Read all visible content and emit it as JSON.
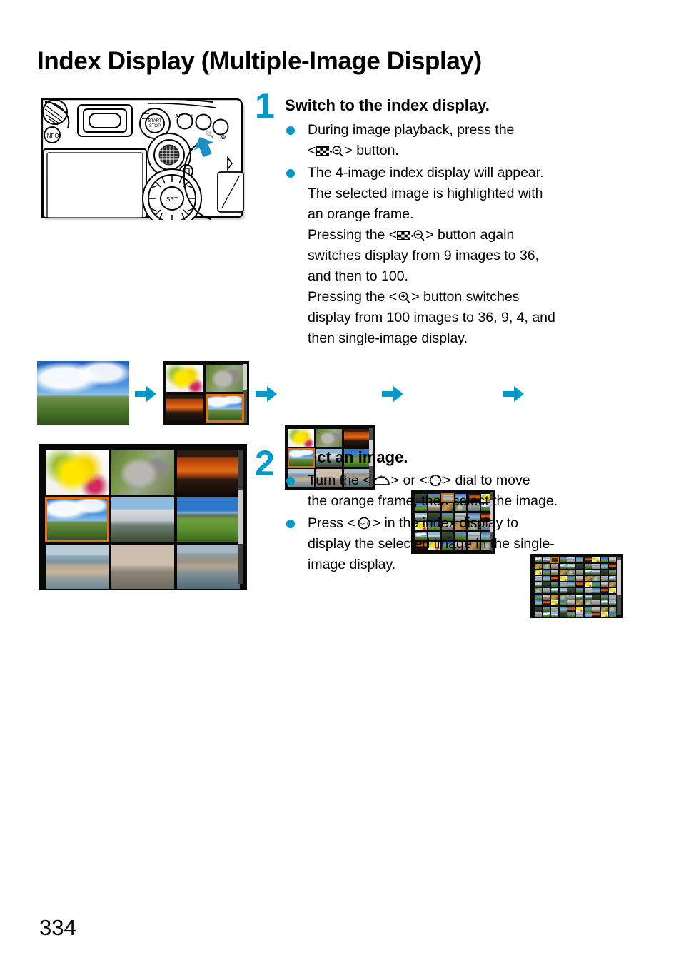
{
  "page": {
    "title": "Index Display (Multiple-Image Display)",
    "number": "334"
  },
  "colors": {
    "accent_cyan": "#0099cc",
    "selection_orange": "#e2710b",
    "text_black": "#000000",
    "lcd_background": "#0a0a0a"
  },
  "steps": [
    {
      "number": "1",
      "heading": "Switch to the index display.",
      "bullets": [
        {
          "lines": [
            {
              "text": "During image playback, press the"
            },
            {
              "pre": "<",
              "icon": "index-magnify-minus-icon",
              "post": "> button."
            }
          ]
        },
        {
          "lines": [
            {
              "text": "The 4-image index display will appear."
            },
            {
              "text": "The selected image is highlighted with"
            },
            {
              "text": "an orange frame."
            },
            {
              "pre": "Pressing the <",
              "icon": "index-magnify-minus-icon",
              "post": "> button again"
            },
            {
              "text": "switches display from 9 images to 36,"
            },
            {
              "text": "and then to 100."
            },
            {
              "pre": "Pressing the <",
              "icon": "magnify-plus-icon",
              "post": "> button switches"
            },
            {
              "text": "display from 100 images to 36, 9, 4, and"
            },
            {
              "text": "then single-image display."
            }
          ]
        }
      ]
    },
    {
      "number": "2",
      "heading": "Select an image.",
      "bullets": [
        {
          "lines": [
            {
              "pre": "Turn the <",
              "icon": "main-dial-icon",
              "mid": "> or <",
              "icon2": "quick-control-dial-icon",
              "post": "> dial to move"
            },
            {
              "text": "the orange frame, then select the image."
            }
          ]
        },
        {
          "lines": [
            {
              "pre": "Press <",
              "icon": "set-button-icon",
              "post": "> in the index display to"
            },
            {
              "text": "display the selected image in the single-"
            },
            {
              "text": "image display."
            }
          ]
        }
      ]
    }
  ],
  "camera_illustration": {
    "name": "camera-rear-view",
    "callout": "blue-arrow-pointing-at-index-magnify-button",
    "labels": [
      "AF-ON",
      "INFO",
      "SET",
      "Q"
    ]
  },
  "sequence": {
    "name": "index-display-progression",
    "arrow_icon": "right-arrow-icon",
    "frames": [
      {
        "label": "single-image display",
        "count": 1,
        "grid": "1x1",
        "selected_index": 0
      },
      {
        "label": "4-image index display",
        "count": 4,
        "grid": "2x2",
        "selected_index": 3
      },
      {
        "label": "9-image index display",
        "count": 9,
        "grid": "3x3",
        "selected_index": 3
      },
      {
        "label": "36-image index display",
        "count": 36,
        "grid": "6x6",
        "selected_index": 2
      },
      {
        "label": "100-image index display",
        "count": 100,
        "grid": "10x10",
        "selected_index": 2
      }
    ]
  },
  "index_panel": {
    "name": "nine-image-index-display",
    "grid": "3x3",
    "selected_index": 3,
    "thumbnails": [
      "yellow-flowers",
      "koala-in-tree",
      "red-canyon-at-dusk",
      "alpine-cabin-meadow",
      "waterfall-with-rainbow",
      "green-mountain-meadow",
      "coastal-city",
      "orange-tram-street",
      "harbor-waterfront"
    ],
    "scrollbar": "vertical-scrollbar"
  }
}
